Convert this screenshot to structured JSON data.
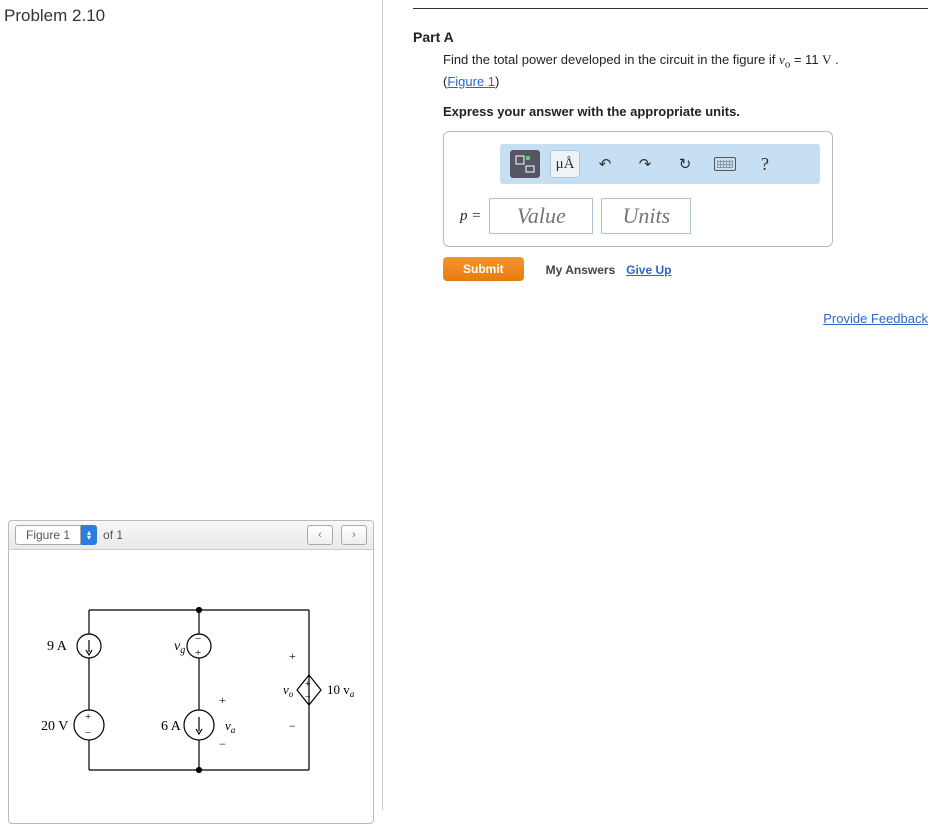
{
  "problem_title": "Problem 2.10",
  "figure_panel": {
    "label": "Figure 1",
    "of_text": "of 1",
    "prev": "‹",
    "next": "›"
  },
  "circuit": {
    "src_9a": "9 A",
    "src_20v": "20 V",
    "src_6a": "6 A",
    "lbl_vg": "v",
    "lbl_vg_sub": "g",
    "lbl_vo": "v",
    "lbl_vo_sub": "o",
    "lbl_va": "v",
    "lbl_va_sub": "a",
    "dep_src": "10 v",
    "dep_src_sub": "a"
  },
  "part": {
    "label": "Part A",
    "prompt_prefix": "Find the total power developed in the circuit in the figure if ",
    "prompt_var": "v",
    "prompt_var_sub": "o",
    "prompt_eq": " = 11 ",
    "prompt_unit": "V",
    "prompt_suffix": " .",
    "figure_link": "Figure 1",
    "instruction": "Express your answer with the appropriate units."
  },
  "toolbar": {
    "template": "▭",
    "units_btn": "μÅ",
    "undo": "↶",
    "redo": "↷",
    "reset": "↻",
    "help": "?"
  },
  "answer": {
    "var": "p =",
    "value_ph": "Value",
    "units_ph": "Units"
  },
  "buttons": {
    "submit": "Submit",
    "my_answers": "My Answers",
    "give_up": "Give Up"
  },
  "feedback_link": "Provide Feedback"
}
